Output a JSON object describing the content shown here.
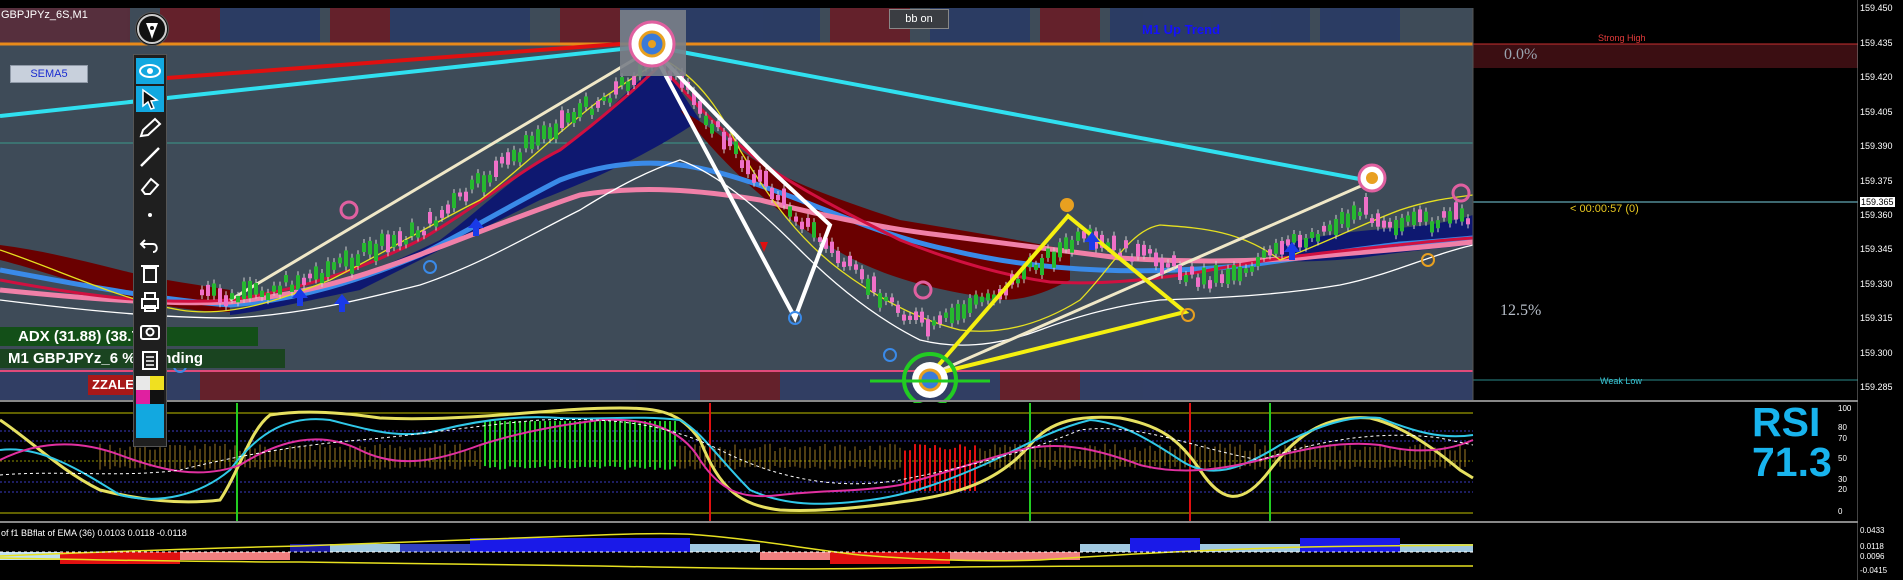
{
  "chart_header": {
    "symbol_timeframe": "GBPJPYz_6S,M1",
    "sema_button": "SEMA5",
    "bb_button": "bb on",
    "trend_label": "M1 Up Trend"
  },
  "price_axis": {
    "labels": [
      "159.450",
      "159.435",
      "159.420",
      "159.405",
      "159.390",
      "159.375",
      "159.360",
      "159.345",
      "159.330",
      "159.315",
      "159.300",
      "159.285"
    ],
    "current_price": "159.365"
  },
  "right_panel": {
    "strong_high_label": "Strong High",
    "weak_low_label": "Weak Low",
    "fib_top": "0.0%",
    "fib_mid": "12.5%",
    "bar_timer": "< 00:00:57 (0)"
  },
  "overlays": {
    "adx_text": "ADX (31.88)    (38.76)",
    "trend_text": "M1 GBPJPYz_6   % Trending",
    "zzal_text": "ZZALE"
  },
  "rsi_panel": {
    "name": "RSI",
    "value": "71.3",
    "levels": [
      "100",
      "80",
      "70",
      "50",
      "30",
      "20",
      "0"
    ]
  },
  "bottom_indicator": {
    "caption": "of f1 BBflat of EMA (36) 0.0103 0.0118 -0.0118",
    "axis_labels": [
      "0.0433",
      "0.0118",
      "0.0096",
      "-0.0415"
    ]
  },
  "toolbar": {
    "items": [
      "eye-icon",
      "cursor-icon",
      "pencil-icon",
      "line-icon",
      "eraser-icon",
      "dot-icon",
      "undo-icon",
      "trash-icon",
      "printer-icon",
      "camera-icon",
      "clipboard-icon",
      "color-palette-icon"
    ]
  },
  "colors": {
    "chart_bg": "#3e4b58",
    "panel_bg": "#000000",
    "bull_candle": "#26b82f",
    "bear_candle": "#f070c8",
    "cyan_line": "#2ee0f0",
    "yellow_zigzag": "#f5f010",
    "rsi_value": "#18b4ee"
  }
}
